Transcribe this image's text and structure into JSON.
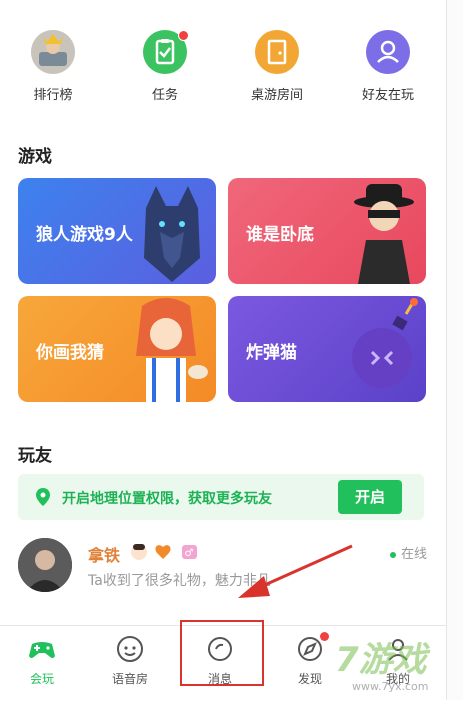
{
  "quick": [
    {
      "label": "排行榜",
      "icon": "avatar-icon",
      "dot": false
    },
    {
      "label": "任务",
      "icon": "task-icon",
      "dot": true
    },
    {
      "label": "桌游房间",
      "icon": "door-icon",
      "dot": false
    },
    {
      "label": "好友在玩",
      "icon": "person-icon",
      "dot": false
    }
  ],
  "games": {
    "title": "游戏",
    "cards": [
      {
        "label": "狼人游戏9人"
      },
      {
        "label": "谁是卧底"
      },
      {
        "label": "你画我猜"
      },
      {
        "label": "炸弹猫"
      }
    ]
  },
  "friends": {
    "title": "玩友",
    "banner_text": "开启地理位置权限，获取更多玩友",
    "banner_button": "开启",
    "item": {
      "name": "拿铁",
      "desc": "Ta收到了很多礼物，魅力非凡",
      "status": "在线"
    }
  },
  "tabs": [
    {
      "label": "会玩"
    },
    {
      "label": "语音房"
    },
    {
      "label": "消息"
    },
    {
      "label": "发现"
    },
    {
      "label": "我的"
    }
  ],
  "watermark": {
    "text": "7游戏",
    "sub": "www.7yx.com"
  },
  "colors": {
    "accent": "#22c05c",
    "dot": "#f04040",
    "highlight": "#d8342c"
  }
}
